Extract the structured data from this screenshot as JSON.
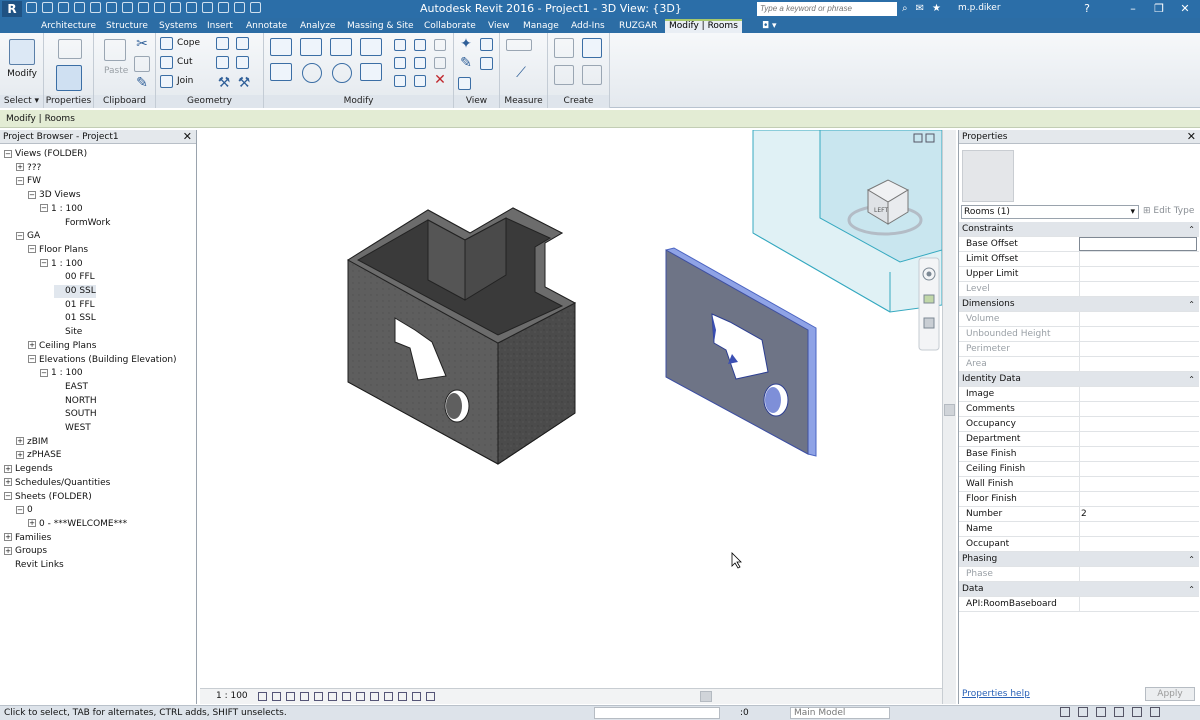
{
  "titlebar": {
    "app_letter": "R",
    "title": "Autodesk Revit 2016 -     Project1 - 3D View: {3D}",
    "search_placeholder": "Type a keyword or phrase",
    "user": "m.p.diker"
  },
  "tabs": [
    "Architecture",
    "Structure",
    "Systems",
    "Insert",
    "Annotate",
    "Analyze",
    "Massing & Site",
    "Collaborate",
    "View",
    "Manage",
    "Add-Ins",
    "RUZGAR",
    "Modify | Rooms"
  ],
  "ribbon": {
    "select": {
      "modify_label": "Modify",
      "panel_label": "Select"
    },
    "properties": {
      "panel_label": "Properties"
    },
    "clipboard": {
      "paste_label": "Paste",
      "panel_label": "Clipboard"
    },
    "geometry": {
      "cope_label": "Cope",
      "cut_label": "Cut",
      "join_label": "Join",
      "panel_label": "Geometry"
    },
    "modify": {
      "panel_label": "Modify"
    },
    "view": {
      "panel_label": "View"
    },
    "measure": {
      "panel_label": "Measure"
    },
    "create": {
      "panel_label": "Create"
    }
  },
  "context_bar": {
    "label": "Modify | Rooms"
  },
  "project_browser": {
    "title": "Project Browser - Project1",
    "nodes": [
      {
        "label": "Views (FOLDER)",
        "toggle": "−"
      },
      {
        "label": "???",
        "toggle": "+"
      },
      {
        "label": "FW",
        "toggle": "−"
      },
      {
        "label": "3D Views",
        "toggle": "−"
      },
      {
        "label": "1 : 100",
        "toggle": "−"
      },
      {
        "label": "FormWork",
        "toggle": ""
      },
      {
        "label": "GA",
        "toggle": "−"
      },
      {
        "label": "Floor Plans",
        "toggle": "−"
      },
      {
        "label": "1 : 100",
        "toggle": "−"
      },
      {
        "label": "00 FFL",
        "toggle": ""
      },
      {
        "label": "00 SSL",
        "toggle": ""
      },
      {
        "label": "01 FFL",
        "toggle": ""
      },
      {
        "label": "01 SSL",
        "toggle": ""
      },
      {
        "label": "Site",
        "toggle": ""
      },
      {
        "label": "Ceiling Plans",
        "toggle": "+"
      },
      {
        "label": "Elevations (Building Elevation)",
        "toggle": "−"
      },
      {
        "label": "1 : 100",
        "toggle": "−"
      },
      {
        "label": "EAST",
        "toggle": ""
      },
      {
        "label": "NORTH",
        "toggle": ""
      },
      {
        "label": "SOUTH",
        "toggle": ""
      },
      {
        "label": "WEST",
        "toggle": ""
      },
      {
        "label": "zBIM",
        "toggle": "+"
      },
      {
        "label": "zPHASE",
        "toggle": "+"
      },
      {
        "label": "Legends",
        "toggle": "+"
      },
      {
        "label": "Schedules/Quantities",
        "toggle": "+"
      },
      {
        "label": "Sheets (FOLDER)",
        "toggle": "−"
      },
      {
        "label": "0",
        "toggle": "−"
      },
      {
        "label": "0 - ***WELCOME***",
        "toggle": "+"
      },
      {
        "label": "Families",
        "toggle": "+"
      },
      {
        "label": "Groups",
        "toggle": "+"
      },
      {
        "label": "Revit Links",
        "toggle": ""
      }
    ]
  },
  "viewport": {
    "scale": "1 : 100"
  },
  "properties": {
    "title": "Properties",
    "selector": "Rooms (1)",
    "edit_type": "Edit Type",
    "groups": [
      {
        "name": "Constraints",
        "rows": [
          {
            "key": "Base Offset",
            "value": ""
          },
          {
            "key": "Limit Offset",
            "value": ""
          },
          {
            "key": "Upper Limit",
            "value": ""
          },
          {
            "key": "Level",
            "value": ""
          }
        ]
      },
      {
        "name": "Dimensions",
        "rows": [
          {
            "key": "Volume",
            "value": ""
          },
          {
            "key": "Unbounded Height",
            "value": ""
          },
          {
            "key": "Perimeter",
            "value": ""
          },
          {
            "key": "Area",
            "value": ""
          }
        ]
      },
      {
        "name": "Identity Data",
        "rows": [
          {
            "key": "Image",
            "value": ""
          },
          {
            "key": "Comments",
            "value": ""
          },
          {
            "key": "Occupancy",
            "value": ""
          },
          {
            "key": "Department",
            "value": ""
          },
          {
            "key": "Base Finish",
            "value": ""
          },
          {
            "key": "Ceiling Finish",
            "value": ""
          },
          {
            "key": "Wall Finish",
            "value": ""
          },
          {
            "key": "Floor Finish",
            "value": ""
          },
          {
            "key": "Number",
            "value": "2"
          },
          {
            "key": "Name",
            "value": ""
          },
          {
            "key": "Occupant",
            "value": ""
          }
        ]
      },
      {
        "name": "Phasing",
        "rows": [
          {
            "key": "Phase",
            "value": ""
          }
        ]
      },
      {
        "name": "Data",
        "rows": [
          {
            "key": "API:RoomBaseboard",
            "value": ""
          }
        ]
      }
    ],
    "help_link": "Properties help",
    "apply_label": "Apply"
  },
  "statusbar": {
    "message": "Click to select, TAB for alternates, CTRL adds, SHIFT unselects.",
    "zero": ":0",
    "model": "Main Model"
  }
}
